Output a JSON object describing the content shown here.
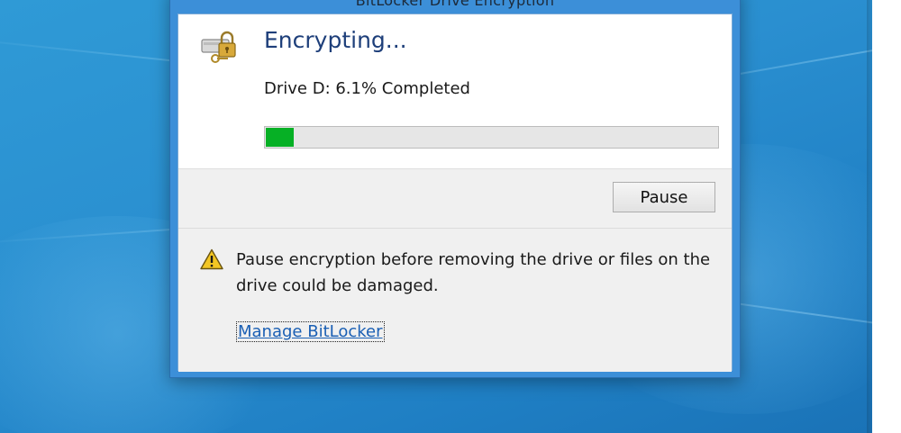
{
  "window": {
    "title": "BitLocker Drive Encryption"
  },
  "header": {
    "heading": "Encrypting...",
    "status": "Drive D: 6.1% Completed",
    "progress_fraction": 0.061
  },
  "actions": {
    "pause_label": "Pause"
  },
  "warning": {
    "text": "Pause encryption before removing the drive or files on the drive could be damaged."
  },
  "links": {
    "manage": "Manage BitLocker"
  },
  "icons": {
    "drive": "drive-lock-icon",
    "warning": "warning-icon"
  },
  "colors": {
    "progress_fill": "#06b025",
    "heading": "#1e3f7a",
    "link": "#1a5fb4",
    "desktop": "#2a8fd0"
  }
}
